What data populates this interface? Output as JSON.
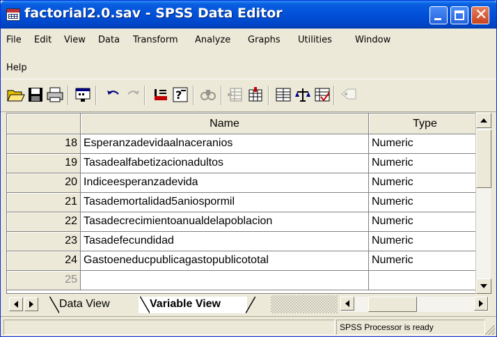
{
  "window": {
    "title": "factorial2.0.sav - SPSS Data Editor"
  },
  "menu": [
    "File",
    "Edit",
    "View",
    "Data",
    "Transform",
    "Analyze",
    "Graphs",
    "Utilities",
    "Window",
    "Help"
  ],
  "toolbar": {
    "icons": [
      "open-folder-icon",
      "save-icon",
      "print-icon",
      "dialog-recall-icon",
      "undo-icon",
      "redo-icon",
      "goto-case-icon",
      "variables-info-icon",
      "find-icon",
      "insert-case-icon",
      "insert-variable-icon",
      "split-file-icon",
      "weight-cases-icon",
      "select-cases-icon",
      "value-labels-icon"
    ]
  },
  "grid": {
    "columns": [
      "Name",
      "Type"
    ],
    "rows": [
      {
        "num": "18",
        "name": "Esperanzadevidaalnaceranios",
        "type": "Numeric"
      },
      {
        "num": "19",
        "name": "Tasadealfabetizacionadultos",
        "type": "Numeric"
      },
      {
        "num": "20",
        "name": "Indiceesperanzadevida",
        "type": "Numeric"
      },
      {
        "num": "21",
        "name": "Tasademortalidad5aniospormil",
        "type": "Numeric"
      },
      {
        "num": "22",
        "name": "Tasadecrecimientoanualdelapoblacion",
        "type": "Numeric"
      },
      {
        "num": "23",
        "name": "Tasadefecundidad",
        "type": "Numeric"
      },
      {
        "num": "24",
        "name": "Gastoeneducpublicagastopublicototal",
        "type": "Numeric"
      },
      {
        "num": "25",
        "name": "",
        "type": ""
      }
    ]
  },
  "tabs": {
    "data_view": "Data View",
    "variable_view": "Variable View"
  },
  "status": {
    "processor": "SPSS Processor  is ready"
  },
  "colors": {
    "titlebar": "#0050d8",
    "chrome": "#ece9d8",
    "grid_lines": "#808080"
  }
}
